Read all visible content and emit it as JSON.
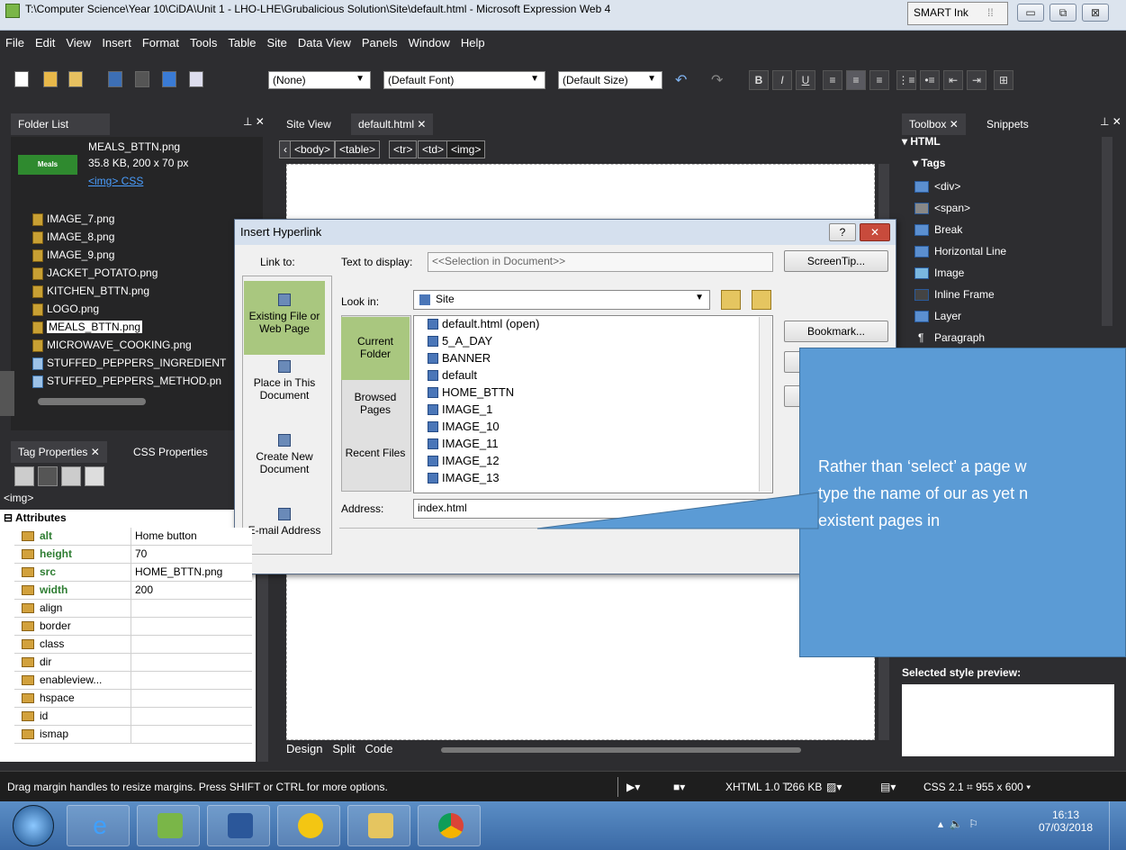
{
  "window": {
    "title": "T:\\Computer Science\\Year 10\\CiDA\\Unit 1 - LHO-LHE\\Grubalicious Solution\\Site\\default.html - Microsoft Expression Web 4",
    "smart_ink": "SMART Ink",
    "minimize": "▭",
    "restore": "⧉",
    "close": "⊠"
  },
  "menu": [
    "File",
    "Edit",
    "View",
    "Insert",
    "Format",
    "Tools",
    "Table",
    "Site",
    "Data View",
    "Panels",
    "Window",
    "Help"
  ],
  "toolbar": {
    "style_value": "(None)",
    "font_value": "(Default Font)",
    "size_value": "(Default Size)",
    "bold": "B",
    "italic": "I",
    "underline": "U"
  },
  "folder_list": {
    "tab": "Folder List",
    "preview_name": "MEALS_BTTN.png",
    "preview_info": "35.8 KB, 200 x 70 px",
    "preview_thumb": "Meals",
    "preview_links": "<img> CSS",
    "files": [
      "IMAGE_7.png",
      "IMAGE_8.png",
      "IMAGE_9.png",
      "JACKET_POTATO.png",
      "KITCHEN_BTTN.png",
      "LOGO.png",
      "MEALS_BTTN.png",
      "MICROWAVE_COOKING.png",
      "STUFFED_PEPPERS_INGREDIENT",
      "STUFFED_PEPPERS_METHOD.pn"
    ]
  },
  "tag_properties": {
    "tab1": "Tag Properties",
    "tab2": "CSS Properties",
    "current_tag": "<img>",
    "section": "Attributes",
    "rows": [
      {
        "name": "alt",
        "value": "Home button"
      },
      {
        "name": "height",
        "value": "70"
      },
      {
        "name": "src",
        "value": "HOME_BTTN.png"
      },
      {
        "name": "width",
        "value": "200"
      },
      {
        "name": "align",
        "value": ""
      },
      {
        "name": "border",
        "value": ""
      },
      {
        "name": "class",
        "value": ""
      },
      {
        "name": "dir",
        "value": ""
      },
      {
        "name": "enableview...",
        "value": ""
      },
      {
        "name": "hspace",
        "value": ""
      },
      {
        "name": "id",
        "value": ""
      },
      {
        "name": "ismap",
        "value": ""
      }
    ]
  },
  "editor": {
    "tab_site": "Site View",
    "tab_doc": "default.html",
    "breadcrumbs": [
      "<body>",
      "<table>",
      "<tr>",
      "<td>",
      "<img>"
    ],
    "view_design": "Design",
    "view_split": "Split",
    "view_code": "Code"
  },
  "toolbox": {
    "tab1": "Toolbox",
    "tab2": "Snippets",
    "group": "HTML",
    "subgroup": "Tags",
    "items": [
      "<div>",
      "<span>",
      "Break",
      "Horizontal Line",
      "Image",
      "Inline Frame",
      "Layer",
      "Paragraph"
    ],
    "style_preview_label": "Selected style preview:"
  },
  "dialog": {
    "title": "Insert Hyperlink",
    "help": "?",
    "close": "✕",
    "link_to_label": "Link to:",
    "text_display_label": "Text to display:",
    "text_display_value": "<<Selection in Document>>",
    "screentip": "ScreenTip...",
    "look_in_label": "Look in:",
    "look_in_value": "Site",
    "bookmark": "Bookmark...",
    "link_options": [
      "Existing File or Web Page",
      "Place in This Document",
      "Create New Document",
      "E-mail Address"
    ],
    "side_buttons": [
      "Current Folder",
      "Browsed Pages",
      "Recent Files"
    ],
    "files": [
      "default.html (open)",
      "5_A_DAY",
      "BANNER",
      "default",
      "HOME_BTTN",
      "IMAGE_1",
      "IMAGE_10",
      "IMAGE_11",
      "IMAGE_12",
      "IMAGE_13"
    ],
    "address_label": "Address:",
    "address_value": "index.html"
  },
  "callout": {
    "text_lines": [
      "Rather than ‘select’ a page w",
      "type the name of our as yet n",
      "existent pages in"
    ]
  },
  "status": {
    "message": "Drag margin handles to resize margins. Press SHIFT or CTRL for more options.",
    "doctype": "XHTML 1.0 T",
    "size": "266 KB",
    "css": "CSS 2.1",
    "dimensions": "955 x 600"
  },
  "taskbar": {
    "time": "16:13",
    "date": "07/03/2018"
  }
}
